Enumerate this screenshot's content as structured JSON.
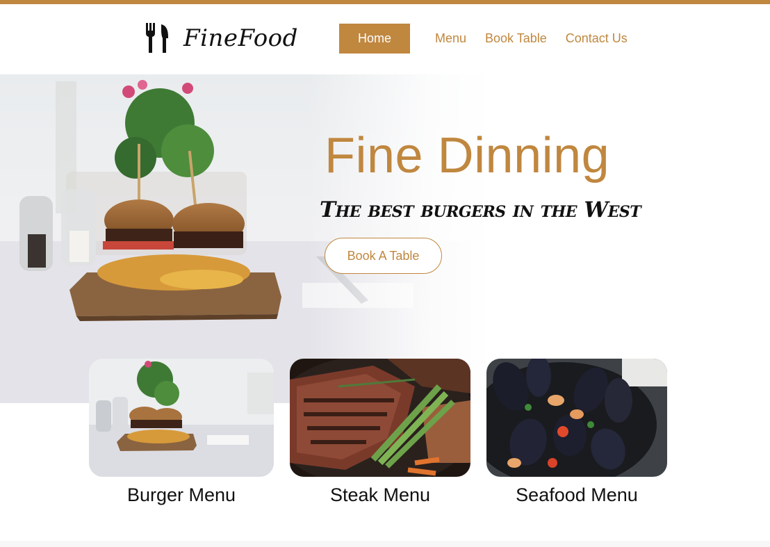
{
  "brand": {
    "name": "FineFood",
    "icon": "fork-knife-icon",
    "accent_color": "#c0873f"
  },
  "nav": {
    "items": [
      {
        "label": "Home",
        "active": true
      },
      {
        "label": "Menu",
        "active": false
      },
      {
        "label": "Book Table",
        "active": false
      },
      {
        "label": "Contact Us",
        "active": false
      }
    ]
  },
  "hero": {
    "title": "Fine Dinning",
    "subtitle": "The best burgers in the West",
    "cta_label": "Book A Table"
  },
  "menus": [
    {
      "label": "Burger Menu",
      "image": "burger-plate-photo"
    },
    {
      "label": "Steak Menu",
      "image": "steak-asparagus-photo"
    },
    {
      "label": "Seafood Menu",
      "image": "mussels-pan-photo"
    }
  ]
}
